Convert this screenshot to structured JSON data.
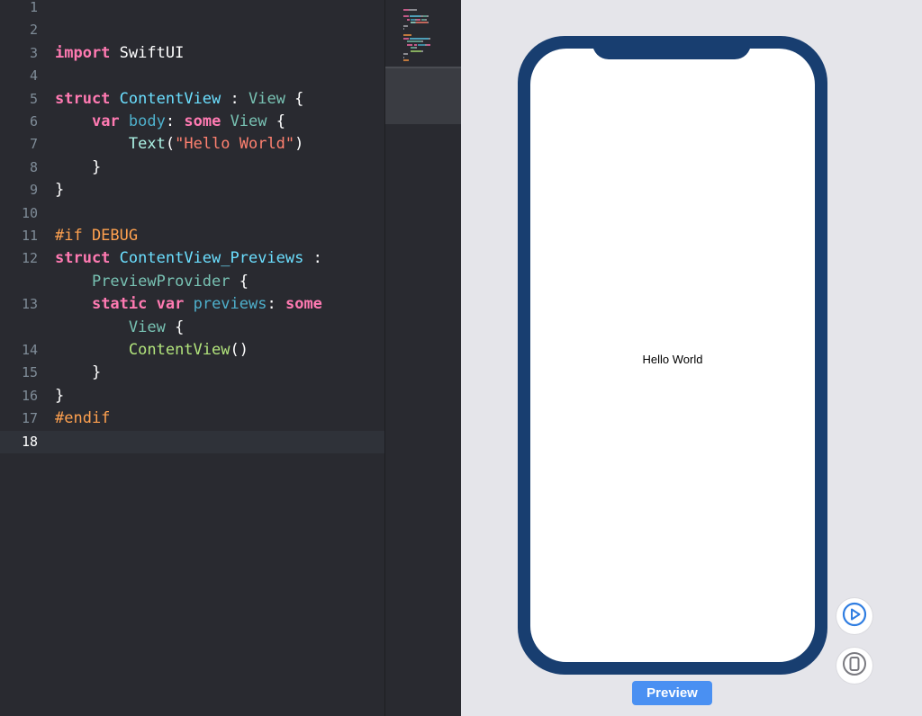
{
  "editor": {
    "lines": [
      {
        "n": "1",
        "tokens": []
      },
      {
        "n": "2",
        "tokens": []
      },
      {
        "n": "3",
        "tokens": [
          {
            "t": "import",
            "c": "kw"
          },
          {
            "t": " SwiftUI",
            "c": ""
          }
        ]
      },
      {
        "n": "4",
        "tokens": []
      },
      {
        "n": "5",
        "tokens": [
          {
            "t": "struct",
            "c": "kw"
          },
          {
            "t": " ",
            "c": ""
          },
          {
            "t": "ContentView",
            "c": "decl"
          },
          {
            "t": " : ",
            "c": ""
          },
          {
            "t": "View",
            "c": "proj"
          },
          {
            "t": " {",
            "c": ""
          }
        ]
      },
      {
        "n": "6",
        "tokens": [
          {
            "t": "    ",
            "c": ""
          },
          {
            "t": "var",
            "c": "kw"
          },
          {
            "t": " ",
            "c": ""
          },
          {
            "t": "body",
            "c": "prop"
          },
          {
            "t": ": ",
            "c": ""
          },
          {
            "t": "some",
            "c": "kw"
          },
          {
            "t": " ",
            "c": ""
          },
          {
            "t": "View",
            "c": "proj"
          },
          {
            "t": " {",
            "c": ""
          }
        ]
      },
      {
        "n": "7",
        "tokens": [
          {
            "t": "        ",
            "c": ""
          },
          {
            "t": "Text",
            "c": "fn"
          },
          {
            "t": "(",
            "c": ""
          },
          {
            "t": "\"Hello World\"",
            "c": "str"
          },
          {
            "t": ")",
            "c": ""
          }
        ]
      },
      {
        "n": "8",
        "tokens": [
          {
            "t": "    }",
            "c": ""
          }
        ]
      },
      {
        "n": "9",
        "tokens": [
          {
            "t": "}",
            "c": ""
          }
        ]
      },
      {
        "n": "10",
        "tokens": []
      },
      {
        "n": "11",
        "tokens": [
          {
            "t": "#if DEBUG",
            "c": "pre"
          }
        ]
      },
      {
        "n": "12",
        "tokens": [
          {
            "t": "struct",
            "c": "kw"
          },
          {
            "t": " ",
            "c": ""
          },
          {
            "t": "ContentView_Previews",
            "c": "decl"
          },
          {
            "t": " :",
            "c": ""
          }
        ]
      },
      {
        "n": "",
        "tokens": [
          {
            "t": "    ",
            "c": ""
          },
          {
            "t": "PreviewProvider",
            "c": "proj"
          },
          {
            "t": " {",
            "c": ""
          }
        ]
      },
      {
        "n": "13",
        "tokens": [
          {
            "t": "    ",
            "c": ""
          },
          {
            "t": "static",
            "c": "kw"
          },
          {
            "t": " ",
            "c": ""
          },
          {
            "t": "var",
            "c": "kw"
          },
          {
            "t": " ",
            "c": ""
          },
          {
            "t": "previews",
            "c": "prop"
          },
          {
            "t": ": ",
            "c": ""
          },
          {
            "t": "some",
            "c": "kw"
          }
        ]
      },
      {
        "n": "",
        "tokens": [
          {
            "t": "        ",
            "c": ""
          },
          {
            "t": "View",
            "c": "proj"
          },
          {
            "t": " {",
            "c": ""
          }
        ]
      },
      {
        "n": "14",
        "tokens": [
          {
            "t": "        ",
            "c": ""
          },
          {
            "t": "ContentView",
            "c": "call"
          },
          {
            "t": "()",
            "c": ""
          }
        ]
      },
      {
        "n": "15",
        "tokens": [
          {
            "t": "    }",
            "c": ""
          }
        ]
      },
      {
        "n": "16",
        "tokens": [
          {
            "t": "}",
            "c": ""
          }
        ]
      },
      {
        "n": "17",
        "tokens": [
          {
            "t": "#endif",
            "c": "pre"
          }
        ]
      },
      {
        "n": "18",
        "tokens": [],
        "current": true
      }
    ]
  },
  "canvas": {
    "hello_text": "Hello World",
    "live_preview_icon": "play-circle-icon",
    "device_preview_icon": "device-icon",
    "preview_button_label": "Preview"
  },
  "colors": {
    "editor_bg": "#292a30",
    "canvas_bg": "#e5e5ea",
    "device_frame": "#183e70",
    "accent": "#4a90f2"
  }
}
